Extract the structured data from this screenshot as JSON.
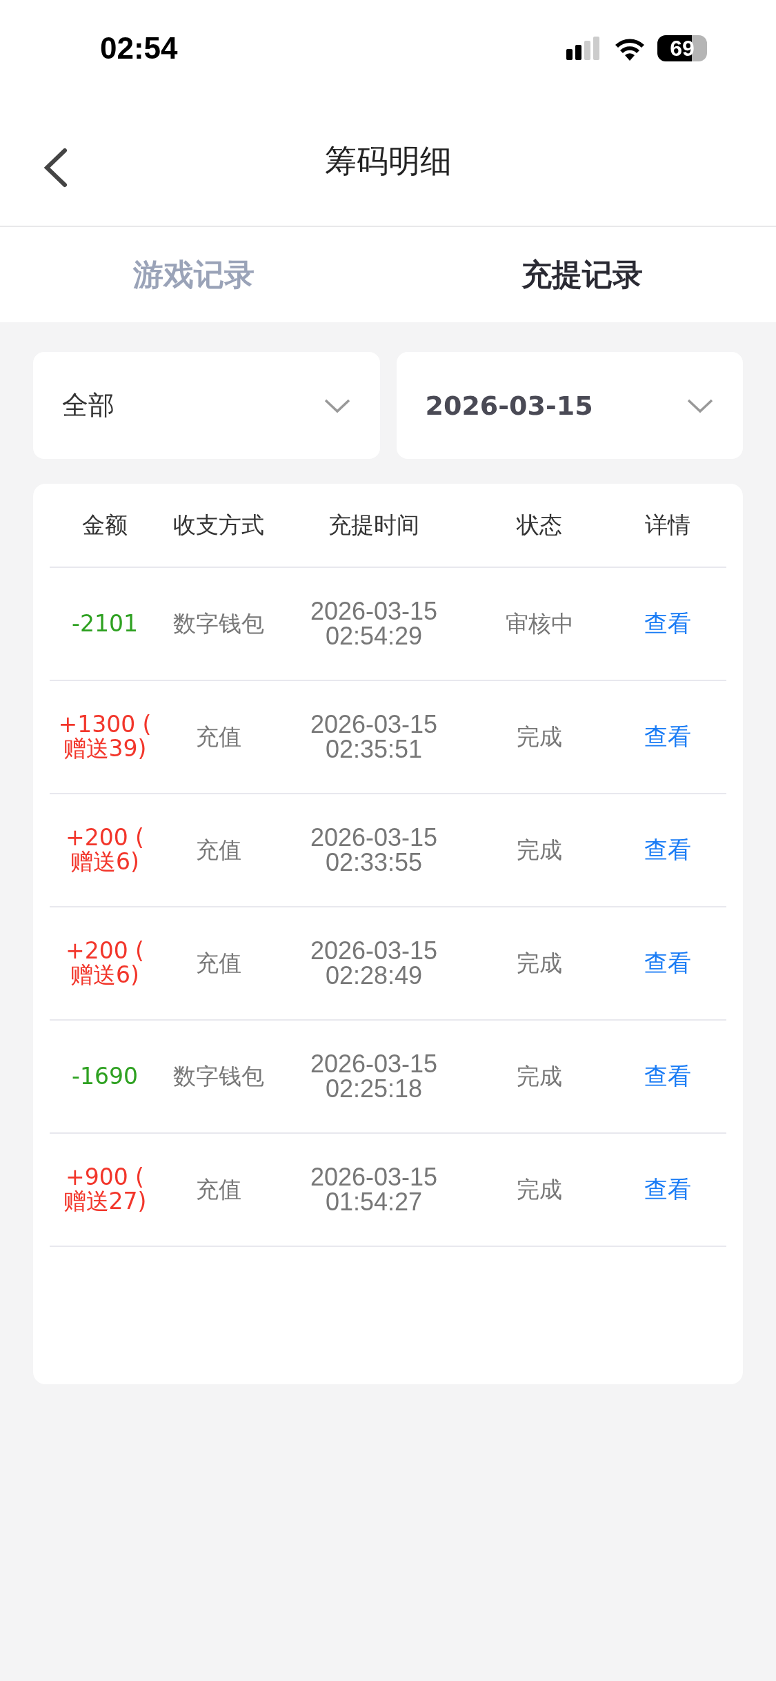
{
  "status_bar": {
    "time": "02:54",
    "battery": "69"
  },
  "nav": {
    "title": "筹码明细"
  },
  "tabs": [
    {
      "label": "游戏记录",
      "selected": false
    },
    {
      "label": "充提记录",
      "selected": true
    }
  ],
  "filters": [
    {
      "value": "全部",
      "bold": false
    },
    {
      "value": "2026-03-15",
      "bold": true
    }
  ],
  "table": {
    "columns": [
      "金额",
      "收支方式",
      "充提时间",
      "状态",
      "详情"
    ],
    "rows": [
      {
        "amount": "-2101",
        "color": "#2ea121",
        "method": "数字钱包",
        "time": "2026-03-15 02:54:29",
        "status": "审核中",
        "action": "查看"
      },
      {
        "amount": "+1300 (\n赠送39)",
        "color": "#f2362b",
        "method": "充值",
        "time": "2026-03-15 02:35:51",
        "status": "完成",
        "action": "查看"
      },
      {
        "amount": "+200 (\n赠送6)",
        "color": "#f2362b",
        "method": "充值",
        "time": "2026-03-15 02:33:55",
        "status": "完成",
        "action": "查看"
      },
      {
        "amount": "+200 (\n赠送6)",
        "color": "#f2362b",
        "method": "充值",
        "time": "2026-03-15 02:28:49",
        "status": "完成",
        "action": "查看"
      },
      {
        "amount": "-1690",
        "color": "#2ea121",
        "method": "数字钱包",
        "time": "2026-03-15 02:25:18",
        "status": "完成",
        "action": "查看"
      },
      {
        "amount": "+900 (\n赠送27)",
        "color": "#f2362b",
        "method": "充值",
        "time": "2026-03-15 01:54:27",
        "status": "完成",
        "action": "查看"
      }
    ]
  }
}
